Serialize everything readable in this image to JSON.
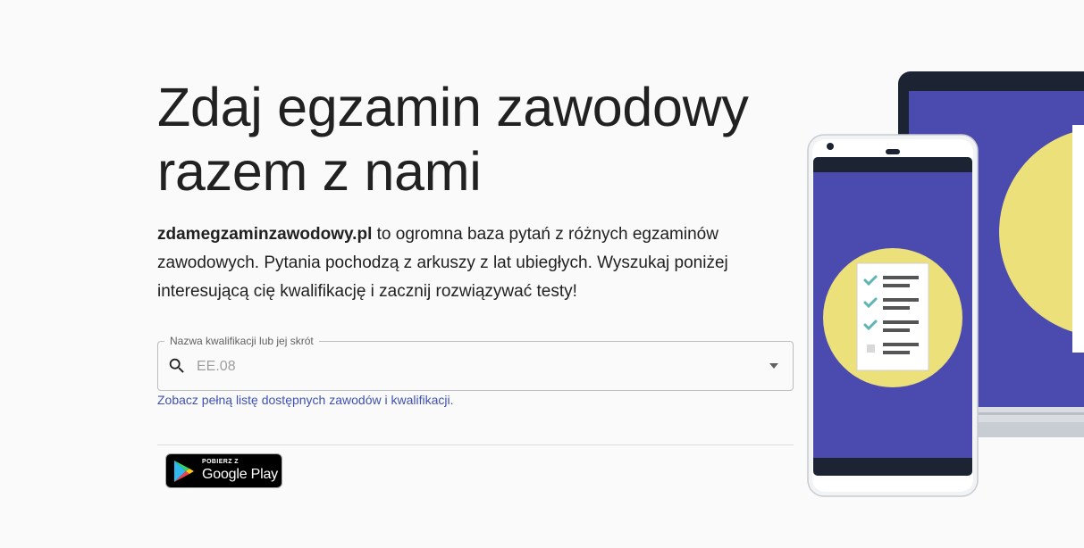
{
  "hero": {
    "title_line1": "Zdaj egzamin zawodowy",
    "title_line2": "razem z nami"
  },
  "intro": {
    "brand": "zdamegzaminzawodowy.pl",
    "text": " to ogromna baza pytań z różnych egzaminów zawodowych. Pytania pochodzą z arkuszy z lat ubiegłych. Wyszukaj poniżej interesującą cię kwalifikację i zacznij rozwiązywać testy!"
  },
  "search": {
    "label": "Nazwa kwalifikacji lub jej skrót",
    "placeholder": "EE.08",
    "value": "",
    "icon": "search-icon",
    "dropdown_icon": "arrow-drop-down-icon"
  },
  "links": {
    "full_list": "Zobacz pełną listę dostępnych zawodów i kwalifikacji."
  },
  "google_play": {
    "small_text": "POBIERZ Z",
    "big_text": "Google Play"
  },
  "colors": {
    "accent": "#3f51b5",
    "screen_blue": "#4a4aaf",
    "illustration_yellow": "#ece07a",
    "check_teal": "#5fb5b5"
  }
}
